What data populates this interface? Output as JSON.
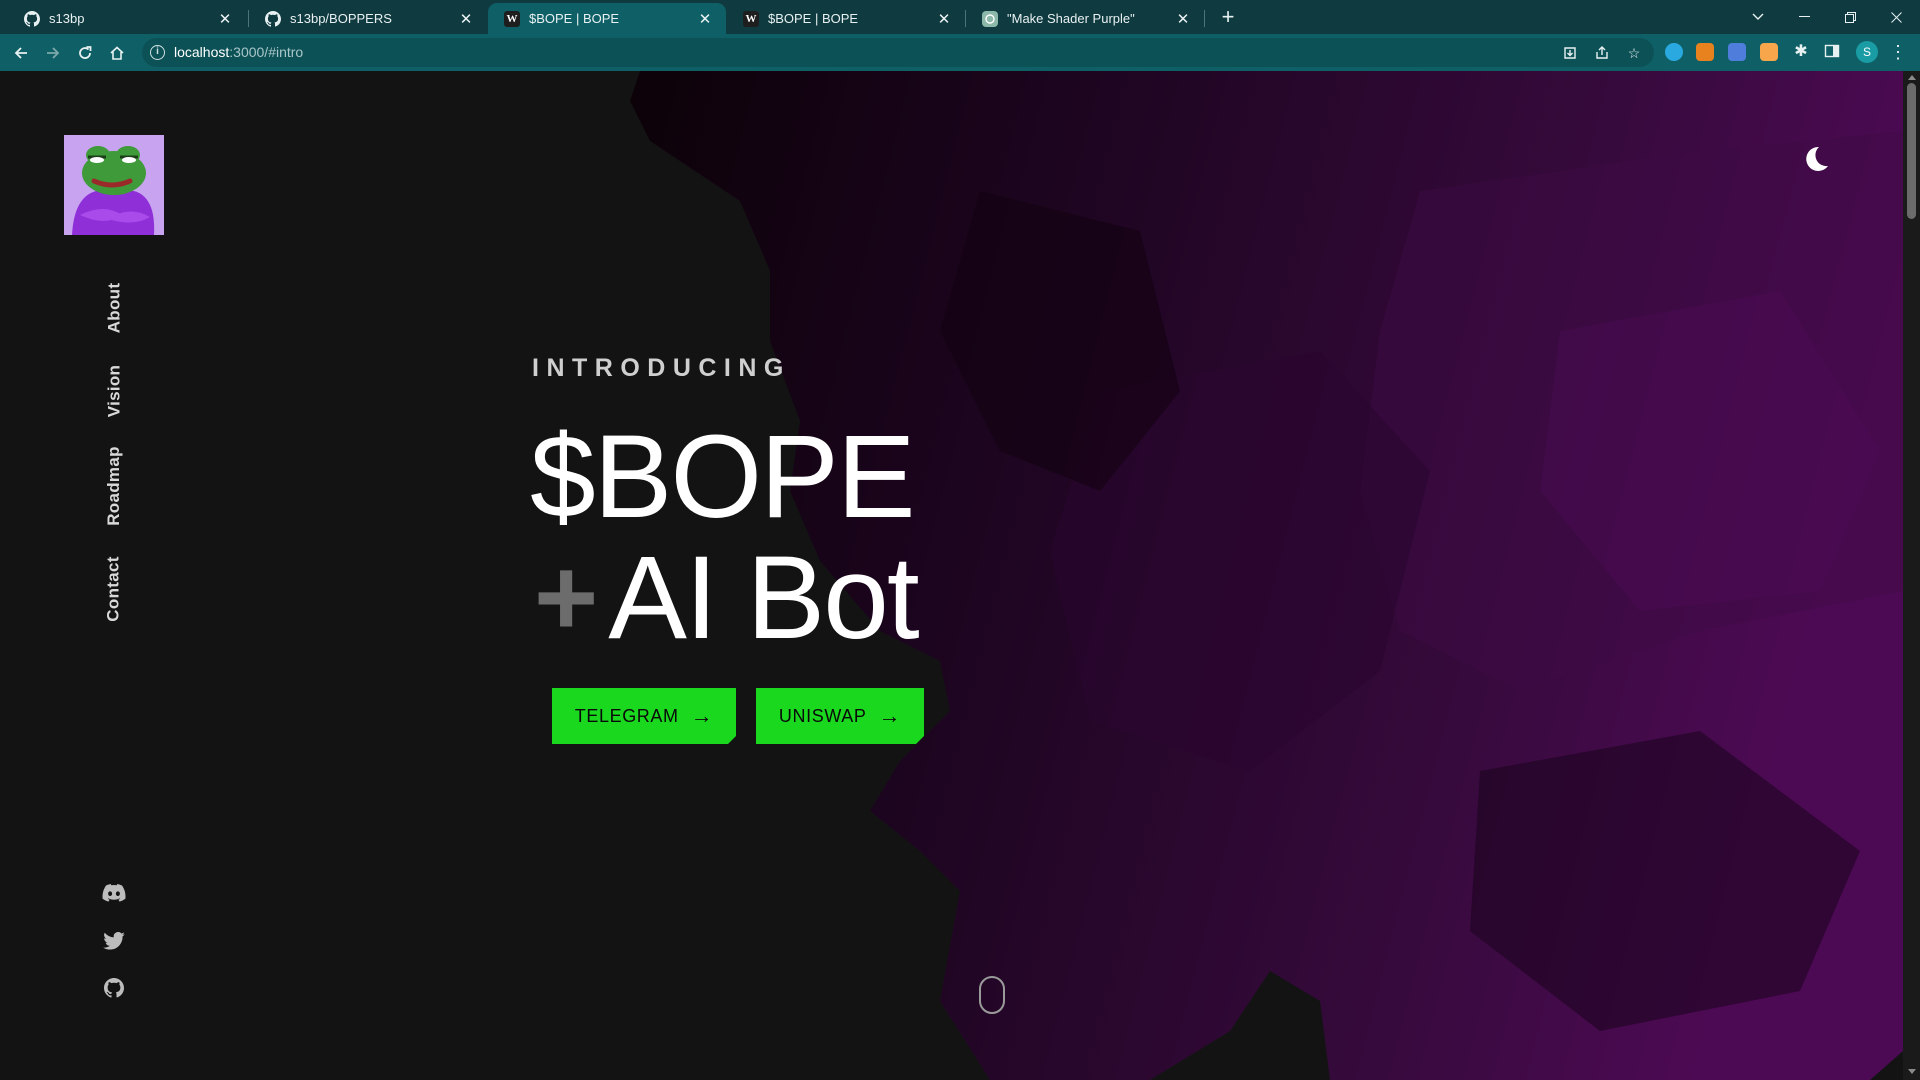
{
  "browser": {
    "tabs": [
      {
        "title": "s13bp",
        "icon": "github-icon",
        "active": false
      },
      {
        "title": "s13bp/BOPPERS",
        "icon": "github-icon",
        "active": false
      },
      {
        "title": "$BOPE | BOPE",
        "icon": "w-logo-icon",
        "active": true
      },
      {
        "title": "$BOPE | BOPE",
        "icon": "w-logo-icon",
        "active": false
      },
      {
        "title": "\"Make Shader Purple\"",
        "icon": "chatgpt-icon",
        "active": false
      }
    ],
    "url_host": "localhost",
    "url_path": ":3000/#intro",
    "profile_initial": "S"
  },
  "page": {
    "nav": [
      "About",
      "Vision",
      "Roadmap",
      "Contact"
    ],
    "hero": {
      "eyebrow": "INTRODUCING",
      "title": "$BOPE",
      "subtitle_plus": "+",
      "subtitle": "AI Bot"
    },
    "buttons": {
      "telegram": "TELEGRAM",
      "uniswap": "UNISWAP"
    },
    "social": [
      "discord-icon",
      "twitter-icon",
      "github-icon"
    ],
    "colors": {
      "accent": "#19d81d",
      "background": "#131313",
      "shader": "#4a0a4f"
    }
  }
}
